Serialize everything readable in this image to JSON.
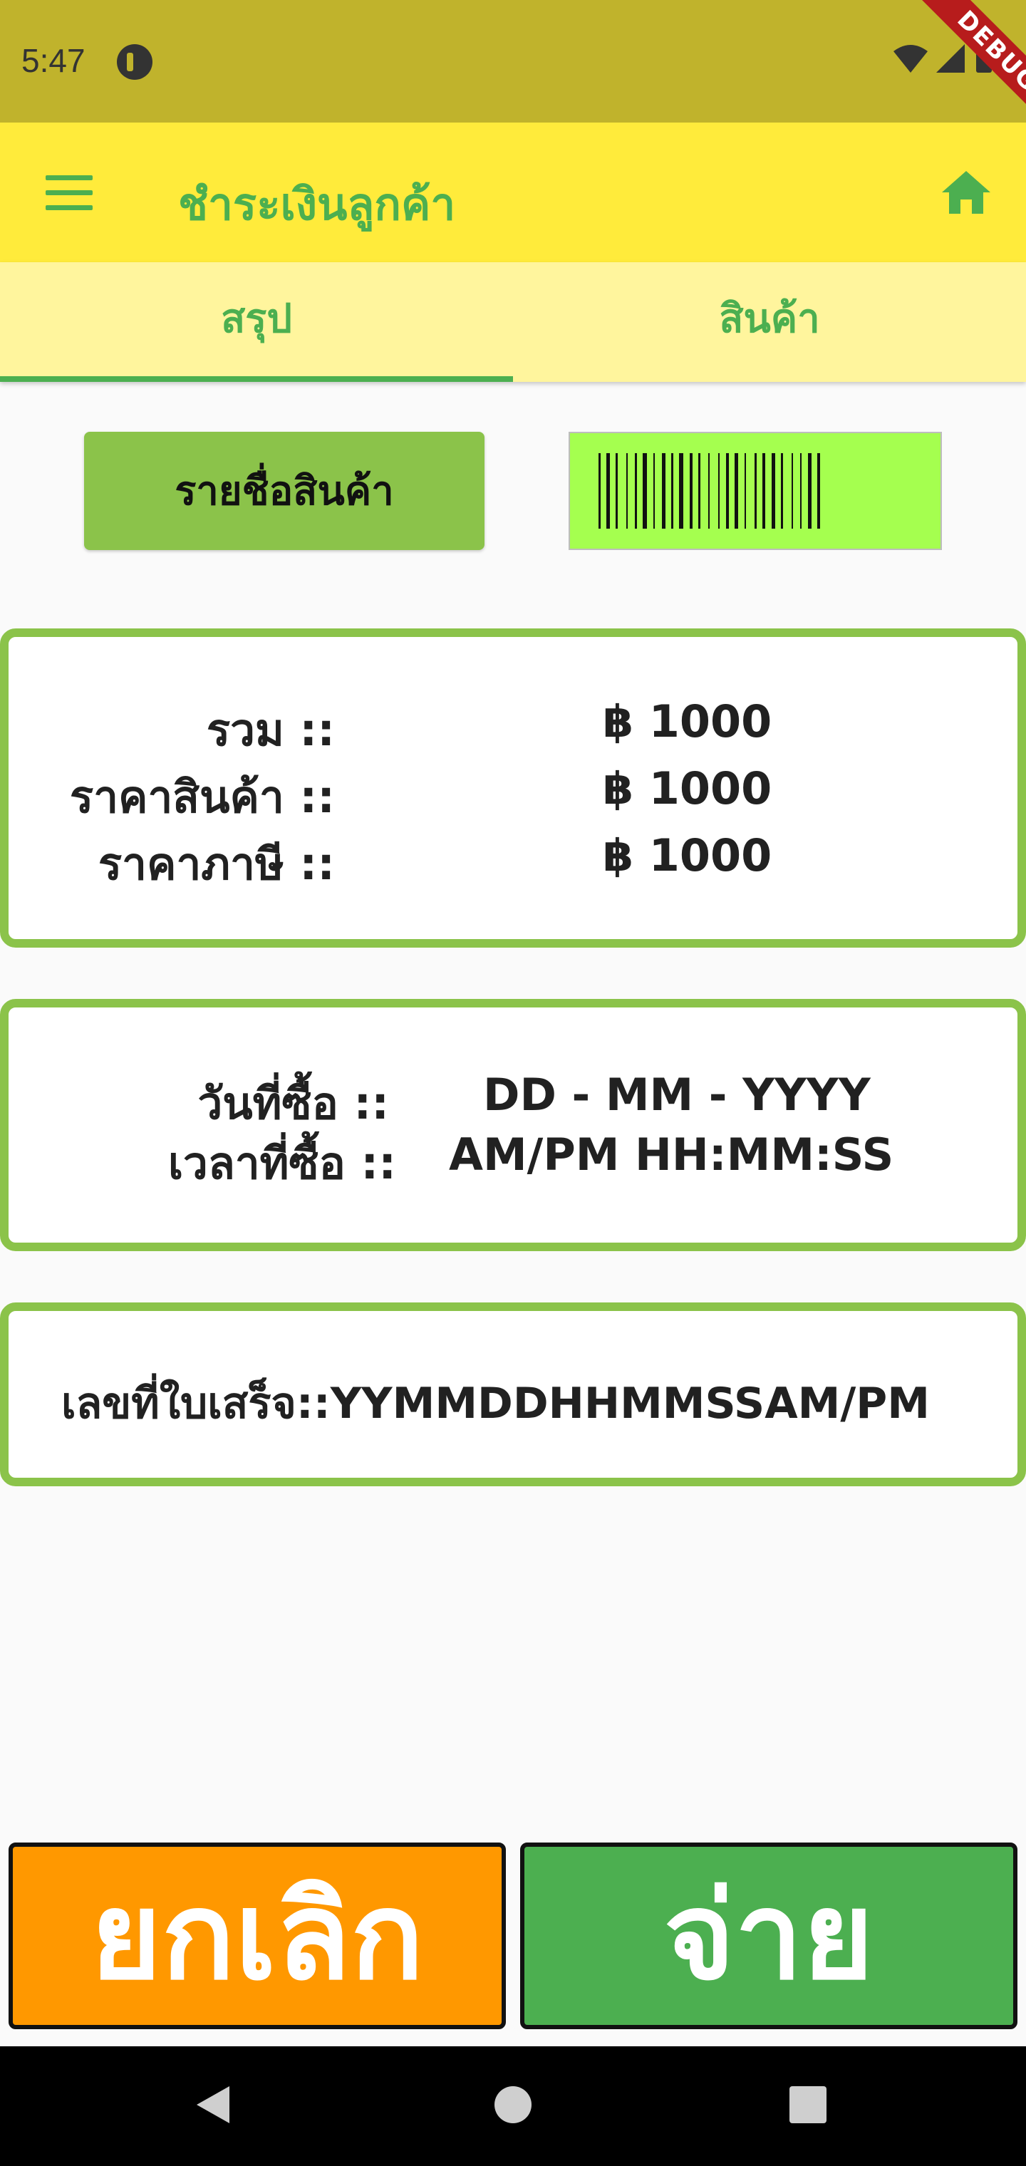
{
  "status_bar": {
    "time": "5:47"
  },
  "debug_banner": "DEBUG",
  "app_bar": {
    "title": "ชำระเงินลูกค้า"
  },
  "tabs": [
    {
      "label": "สรุป",
      "selected": true
    },
    {
      "label": "สินค้า",
      "selected": false
    }
  ],
  "actions": {
    "product_list_label": "รายชื่อสินค้า"
  },
  "summary": {
    "total_label": "รวม ::",
    "total_value": "฿ 1000",
    "product_price_label": "ราคาสินค้า ::",
    "product_price_value": "฿ 1000",
    "tax_label": "ราคาภาษี ::",
    "tax_value": "฿ 1000"
  },
  "purchase": {
    "date_label": "วันที่ซื้อ ::",
    "date_value": "DD - MM - YYYY",
    "time_label": "เวลาที่ซื้อ ::",
    "time_value": "AM/PM  HH:MM:SS"
  },
  "receipt": {
    "label": "เลขที่ใบเสร็จ::YYMMDDHHMMSSAM/PM"
  },
  "bottom": {
    "cancel_label": "ยกเลิก",
    "pay_label": "จ่าย"
  },
  "colors": {
    "status_bar": "#c0b32c",
    "app_bar": "#ffeb3b",
    "tab_bar": "#fff59d",
    "accent_green": "#4caf50",
    "light_green": "#8bc34a",
    "barcode_bg": "#a5ff4f",
    "cancel_orange": "#ff9800"
  }
}
